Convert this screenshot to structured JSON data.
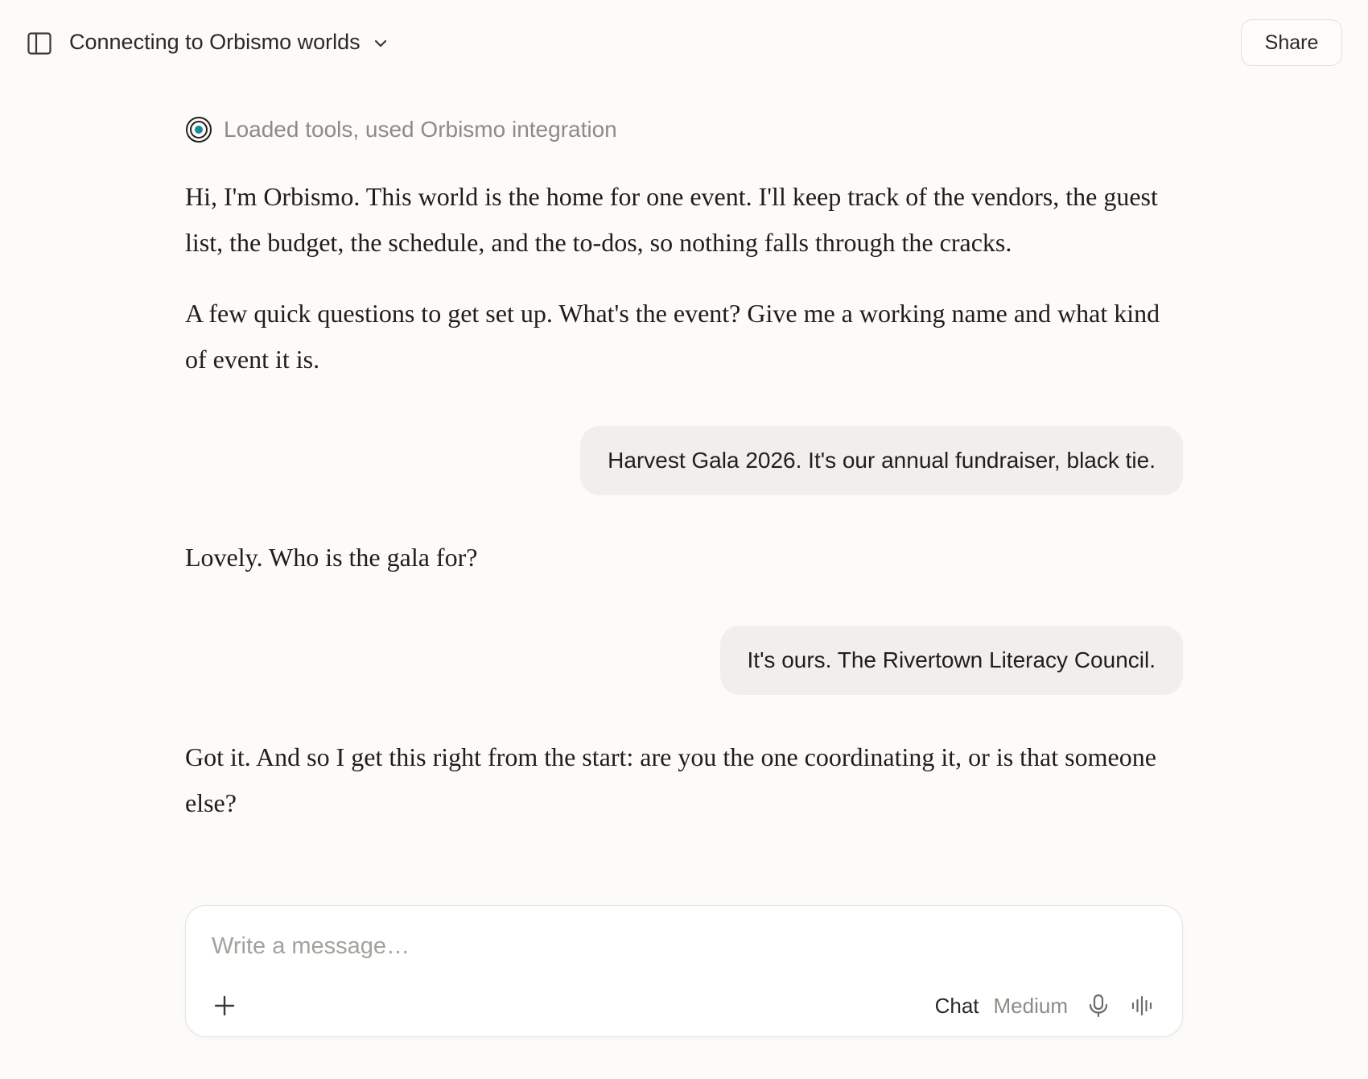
{
  "header": {
    "title": "Connecting to Orbismo worlds",
    "share_label": "Share"
  },
  "tool_status": {
    "text": "Loaded tools, used Orbismo integration",
    "icon": "orbismo-target-icon",
    "accent": "#1a8a9a"
  },
  "messages": [
    {
      "role": "assistant",
      "text": "Hi, I'm Orbismo. This world is the home for one event. I'll keep track of the vendors, the guest list, the budget, the schedule, and the to-dos, so nothing falls through the cracks."
    },
    {
      "role": "assistant",
      "text": "A few quick questions to get set up. What's the event? Give me a working name and what kind of event it is."
    },
    {
      "role": "user",
      "text": "Harvest Gala 2026. It's our annual fundraiser, black tie."
    },
    {
      "role": "assistant",
      "text": "Lovely. Who is the gala for?"
    },
    {
      "role": "user",
      "text": "It's ours. The Rivertown Literacy Council."
    },
    {
      "role": "assistant",
      "text": "Got it. And so I get this right from the start: are you the one coordinating it, or is that someone else?"
    }
  ],
  "composer": {
    "placeholder": "Write a message…",
    "value": "",
    "mode_label": "Chat",
    "model_label": "Medium"
  },
  "icons": {
    "sidebar_toggle": "sidebar-toggle-icon",
    "title_dropdown": "chevron-down-icon",
    "add": "plus-icon",
    "mic": "microphone-icon",
    "voice": "voice-waveform-icon"
  }
}
